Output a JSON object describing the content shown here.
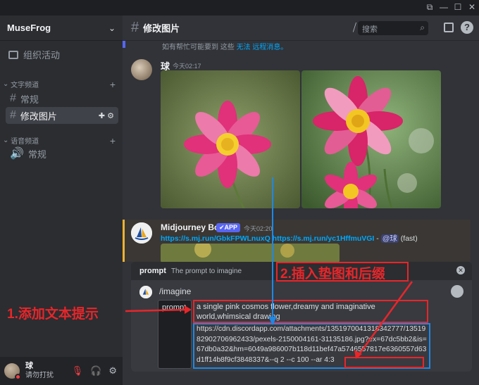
{
  "window": {
    "controls": [
      "⧉",
      "—",
      "☐",
      "✕"
    ]
  },
  "sidebar": {
    "server_name": "MuseFrog",
    "events_label": "组织活动",
    "text_category": "文字频道",
    "voice_category": "语音频道",
    "channels": [
      "常规",
      "修改图片"
    ],
    "voice_channels": [
      "常规"
    ],
    "active_channel_tools": "✚ ⚙"
  },
  "user": {
    "name": "球",
    "status": "请勿打扰"
  },
  "header": {
    "channel_title": "修改图片",
    "search_placeholder": "搜索"
  },
  "messages": {
    "top_note": "如有帮忙可能要到 这些",
    "top_note_link": "无法 远程消息。",
    "user_message": {
      "author": "球",
      "time": "今天02:17"
    },
    "bot_message": {
      "author": "Midjourney Bot",
      "badge": "✔APP",
      "time": "今天02:20",
      "link1": "https://s.mj.run/GbkFPWLnuxQ",
      "link2": "https://s.mj.run/yc1HffmuVGI",
      "separator": " - ",
      "mention": "@球",
      "mode": " (fast)"
    }
  },
  "popup": {
    "key": "prompt",
    "description": "The prompt to imagine"
  },
  "composer": {
    "command": "/imagine",
    "option_label": "prompt",
    "prompt_text": "a single pink cosmos flower,dreamy and imaginative world,whimsical drawing",
    "url_text": "https://cdn.discordapp.com/attachments/1351970041318342777/1351982902706962433/pexels-2150004161-31135186.jpg?ex=67dc5bb2&is=67db0a32&hm=6049a986007b118d11bef47a5746557817e6360557d63d1ff14b8f9cf3848337&",
    "suffix_text": "--q 2 --c 100 --ar 4:3"
  },
  "annotations": {
    "step1": "1.添加文本提示",
    "step2": "2.插入垫图和后缀"
  },
  "colors": {
    "annotation_red": "#e8262a",
    "annotation_blue": "#1e88e5",
    "brand": "#5865f2",
    "flower_pink": "#e0317a"
  }
}
